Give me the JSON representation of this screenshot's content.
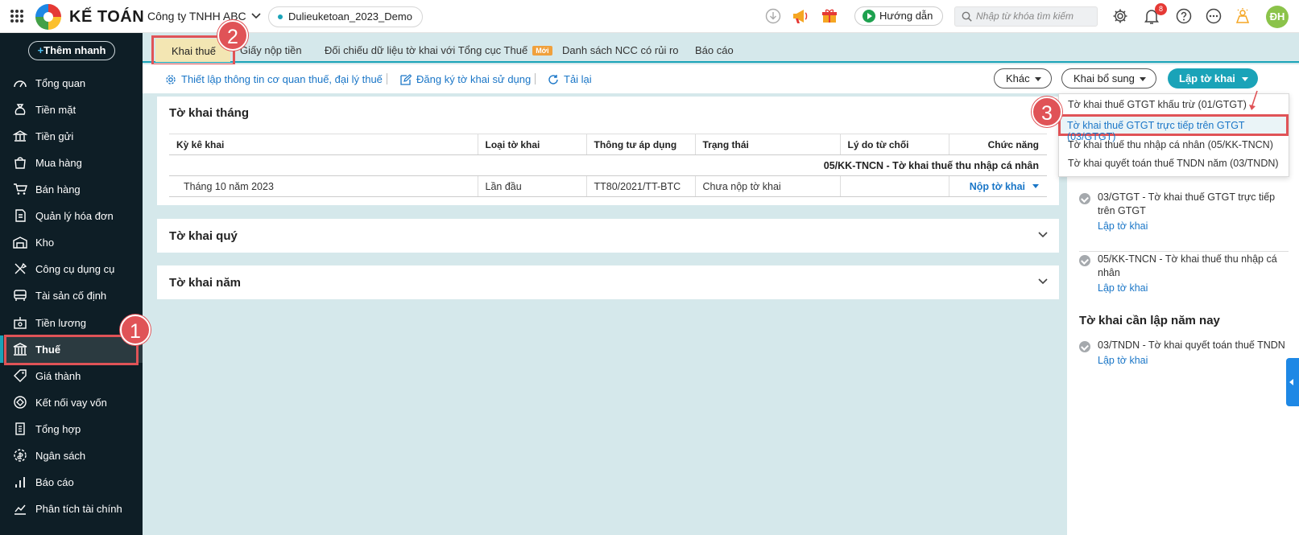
{
  "app": {
    "logo_text": "KẾ TOÁN",
    "company": "Công ty TNHH ABC",
    "dataset": "Dulieuketoan_2023_Demo",
    "guide_label": "Hướng dẫn",
    "search_placeholder": "Nhập từ khóa tìm kiếm",
    "notification_count": "8",
    "avatar_initials": "ĐH"
  },
  "sidebar": {
    "quick_add_plus": "+",
    "quick_add": "Thêm nhanh",
    "items": [
      {
        "label": "Tổng quan",
        "icon": "dashboard-icon"
      },
      {
        "label": "Tiền mặt",
        "icon": "money-bag-icon"
      },
      {
        "label": "Tiền gửi",
        "icon": "bank-deposit-icon"
      },
      {
        "label": "Mua hàng",
        "icon": "shopping-bag-icon"
      },
      {
        "label": "Bán hàng",
        "icon": "cart-icon"
      },
      {
        "label": "Quản lý hóa đơn",
        "icon": "invoice-icon"
      },
      {
        "label": "Kho",
        "icon": "warehouse-icon"
      },
      {
        "label": "Công cụ dụng cụ",
        "icon": "tools-icon"
      },
      {
        "label": "Tài sản cố định",
        "icon": "asset-icon"
      },
      {
        "label": "Tiền lương",
        "icon": "salary-icon"
      },
      {
        "label": "Thuế",
        "icon": "tax-building-icon"
      },
      {
        "label": "Giá thành",
        "icon": "price-tag-icon"
      },
      {
        "label": "Kết nối vay vốn",
        "icon": "loan-icon"
      },
      {
        "label": "Tổng hợp",
        "icon": "summary-icon"
      },
      {
        "label": "Ngân sách",
        "icon": "budget-icon"
      },
      {
        "label": "Báo cáo",
        "icon": "report-icon"
      },
      {
        "label": "Phân tích tài chính",
        "icon": "analysis-icon"
      }
    ],
    "active_item": "Thuế"
  },
  "tabs": [
    {
      "label": "Khai thuế"
    },
    {
      "label": "Giấy nộp tiền"
    },
    {
      "label": "Đối chiếu dữ liệu tờ khai với Tổng cục Thuế",
      "badge": "Mới"
    },
    {
      "label": "Danh sách NCC có rủi ro"
    },
    {
      "label": "Báo cáo"
    }
  ],
  "toolbar": {
    "setup_link": "Thiết lập thông tin cơ quan thuế, đại lý thuế",
    "register_link": "Đăng ký tờ khai sử dụng",
    "reload_link": "Tải lại",
    "other_btn": "Khác",
    "supplement_btn": "Khai bổ sung",
    "create_btn": "Lập tờ khai"
  },
  "monthly": {
    "title": "Tờ khai tháng",
    "columns": [
      "Kỳ kê khai",
      "Loại tờ khai",
      "Thông tư áp dụng",
      "Trạng thái",
      "Lý do từ chối",
      "Chức năng"
    ],
    "group": "05/KK-TNCN - Tờ khai thuế thu nhập cá nhân",
    "row": {
      "period": "Tháng 10 năm 2023",
      "type": "Lần đầu",
      "circular": "TT80/2021/TT-BTC",
      "status": "Chưa nộp tờ khai",
      "reason": "",
      "action": "Nộp tờ khai"
    }
  },
  "quarterly": {
    "title": "Tờ khai quý"
  },
  "yearly": {
    "title": "Tờ khai năm"
  },
  "dropdown": {
    "items": [
      "Tờ khai thuế GTGT khấu trừ (01/GTGT)",
      "Tờ khai thuế GTGT trực tiếp trên GTGT (03/GTGT)",
      "Tờ khai thuế thu nhập cá nhân (05/KK-TNCN)",
      "Tờ khai quyết toán thuế TNDN năm (03/TNDN)"
    ],
    "highlighted": "Tờ khai thuế GTGT trực tiếp trên GTGT (03/GTGT)"
  },
  "right_panel": {
    "items": [
      {
        "text": "03/GTGT - Tờ khai thuế GTGT trực tiếp trên GTGT",
        "link": "Lập tờ khai"
      },
      {
        "text": "05/KK-TNCN - Tờ khai thuế thu nhập cá nhân",
        "link": "Lập tờ khai"
      }
    ],
    "year_heading": "Tờ khai cần lập năm nay",
    "year_items": [
      {
        "text": "03/TNDN - Tờ khai quyết toán thuế TNDN",
        "link": "Lập tờ khai"
      }
    ]
  },
  "annotations": {
    "step1": "1",
    "step2": "2",
    "step3": "3"
  },
  "colors": {
    "accent": "#1aa3b8",
    "sidebar_bg": "#0e1e26",
    "highlight": "#e05357",
    "link": "#1a76c7",
    "content_bg": "#d5e8eb"
  }
}
